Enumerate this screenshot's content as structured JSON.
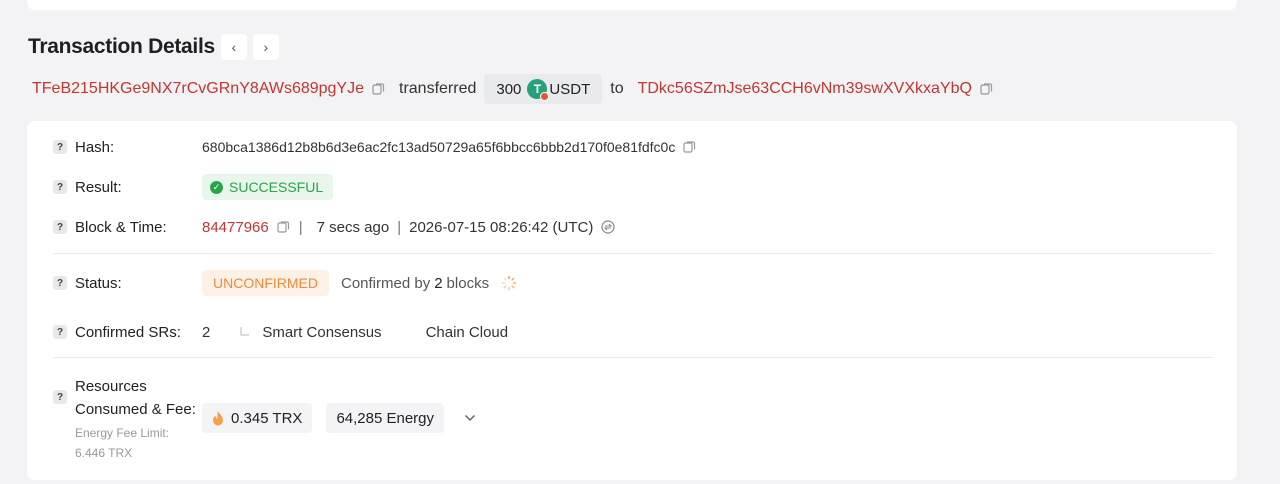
{
  "header": {
    "title": "Transaction Details",
    "prev_label": "‹",
    "next_label": "›"
  },
  "summary": {
    "from_address": "TFeB215HKGe9NX7rCvGRnY8AWs689pgYJe",
    "action": "transferred",
    "amount": "300",
    "token": "USDT",
    "to_word": "to",
    "to_address": "TDkc56SZmJse63CCH6vNm39swXVXkxaYbQ"
  },
  "details": {
    "hash_label": "Hash:",
    "hash": "680bca1386d12b8b6d3e6ac2fc13ad50729a65f6bbcc6bbb2d170f0e81fdfc0c",
    "result_label": "Result:",
    "result": "SUCCESSFUL",
    "block_label": "Block & Time:",
    "block": "84477966",
    "age": "7 secs ago",
    "time": "2026-07-15 08:26:42 (UTC)",
    "status_label": "Status:",
    "status": "UNCONFIRMED",
    "confirmed_prefix": "Confirmed by",
    "confirmed_count": "2",
    "confirmed_suffix": "blocks",
    "srs_label": "Confirmed SRs:",
    "srs_count": "2",
    "sr_names": [
      "Smart Consensus",
      "Chain Cloud"
    ],
    "resources_label_1": "Resources",
    "resources_label_2": "Consumed & Fee:",
    "energy_fee_limit_label": "Energy Fee Limit:",
    "energy_fee_limit": "6.446 TRX",
    "fee_trx": "0.345 TRX",
    "energy": "64,285 Energy",
    "question_mark": "?"
  },
  "colors": {
    "address": "#c23631",
    "success": "#2aa44b",
    "unconfirmed": "#ee8a3a",
    "token": "#26a17b"
  }
}
